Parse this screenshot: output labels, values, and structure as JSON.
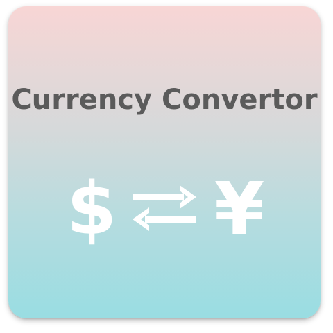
{
  "app": {
    "title": "Currency Convertor"
  },
  "icons": {
    "from_symbol": "$",
    "to_symbol": "¥",
    "swap_icon": "swap-arrows-icon"
  },
  "colors": {
    "gradient_top": "#f8d6d5",
    "gradient_bottom": "#99dde2",
    "title": "#5b5b5b",
    "icon": "#ffffff"
  }
}
